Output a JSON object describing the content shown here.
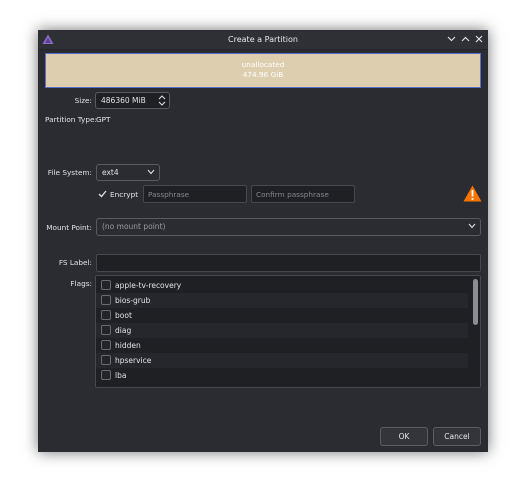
{
  "window": {
    "title": "Create a Partition",
    "colors": {
      "background": "#2b2c31",
      "titlebar": "#2f3036",
      "accent": "#5a6fc8"
    }
  },
  "partition_bar": {
    "label": "unallocated",
    "size": "474.96 GiB",
    "color": "#ddceb0"
  },
  "size": {
    "label": "Size:",
    "value": "486360 MiB"
  },
  "partition_type": {
    "label": "Partition Type:",
    "value": "GPT"
  },
  "file_system": {
    "label": "File System:",
    "value": "ext4"
  },
  "encrypt": {
    "label": "Encrypt",
    "checked": true,
    "passphrase_placeholder": "Passphrase",
    "confirm_placeholder": "Confirm passphrase",
    "warning_icon": "warning-triangle-icon",
    "warning_color": "#f67400"
  },
  "mount_point": {
    "label": "Mount Point:",
    "value": "(no mount point)"
  },
  "fs_label": {
    "label": "FS Label:",
    "value": ""
  },
  "flags": {
    "label": "Flags:",
    "items": [
      "apple-tv-recovery",
      "bios-grub",
      "boot",
      "diag",
      "hidden",
      "hpservice",
      "lba"
    ]
  },
  "buttons": {
    "ok": "OK",
    "cancel": "Cancel"
  }
}
